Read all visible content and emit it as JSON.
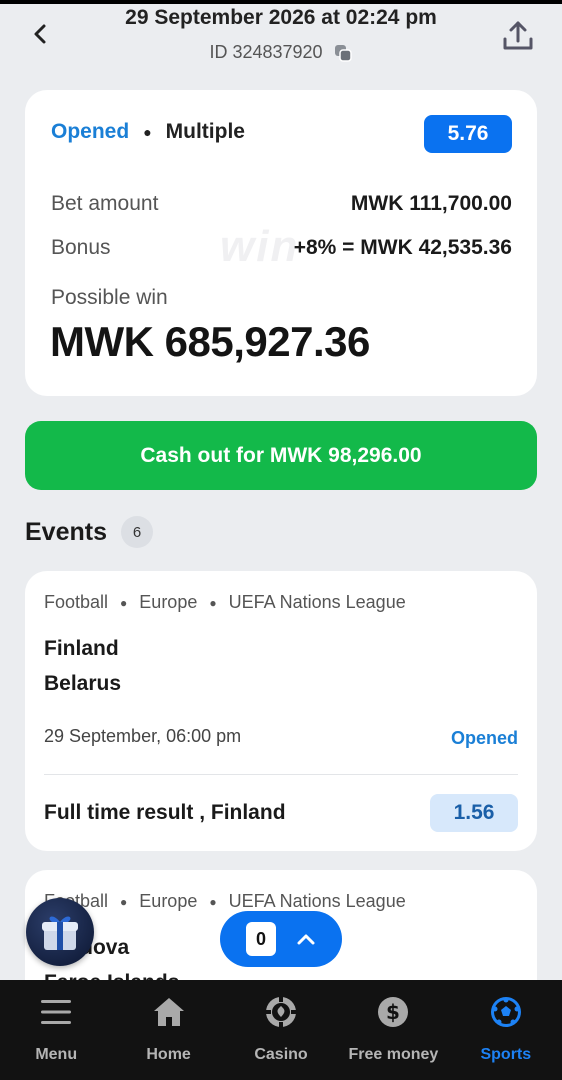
{
  "header": {
    "title": "29 September 2026 at 02:24 pm",
    "id_text": "ID 324837920"
  },
  "summary": {
    "status": "Opened",
    "bet_type": "Multiple",
    "total_odds": "5.76",
    "bet_amount_label": "Bet amount",
    "bet_amount_value": "MWK 111,700.00",
    "bonus_label": "Bonus",
    "bonus_value": "+8% = MWK 42,535.36",
    "possible_win_label": "Possible win",
    "possible_win_value": "MWK 685,927.36"
  },
  "cashout": {
    "label": "Cash out for MWK 98,296.00"
  },
  "events": {
    "title": "Events",
    "count": "6",
    "items": [
      {
        "sport": "Football",
        "region": "Europe",
        "league": "UEFA Nations League",
        "team1": "Finland",
        "team2": "Belarus",
        "date": "29 September, 06:00 pm",
        "status": "Opened",
        "market": "Full time result , Finland",
        "odds": "1.56"
      },
      {
        "sport": "Football",
        "region": "Europe",
        "league": "UEFA Nations League",
        "team1": "Moldova",
        "team2": "Faroe Islands"
      }
    ]
  },
  "bet_slip": {
    "count": "0"
  },
  "bottom_nav": {
    "items": [
      {
        "label": "Menu"
      },
      {
        "label": "Home"
      },
      {
        "label": "Casino"
      },
      {
        "label": "Free money"
      },
      {
        "label": "Sports"
      }
    ]
  },
  "colors": {
    "accent": "#0a72f0",
    "cashout": "#13b94a",
    "status": "#1a7fd6",
    "nav_active": "#1d82f5"
  }
}
